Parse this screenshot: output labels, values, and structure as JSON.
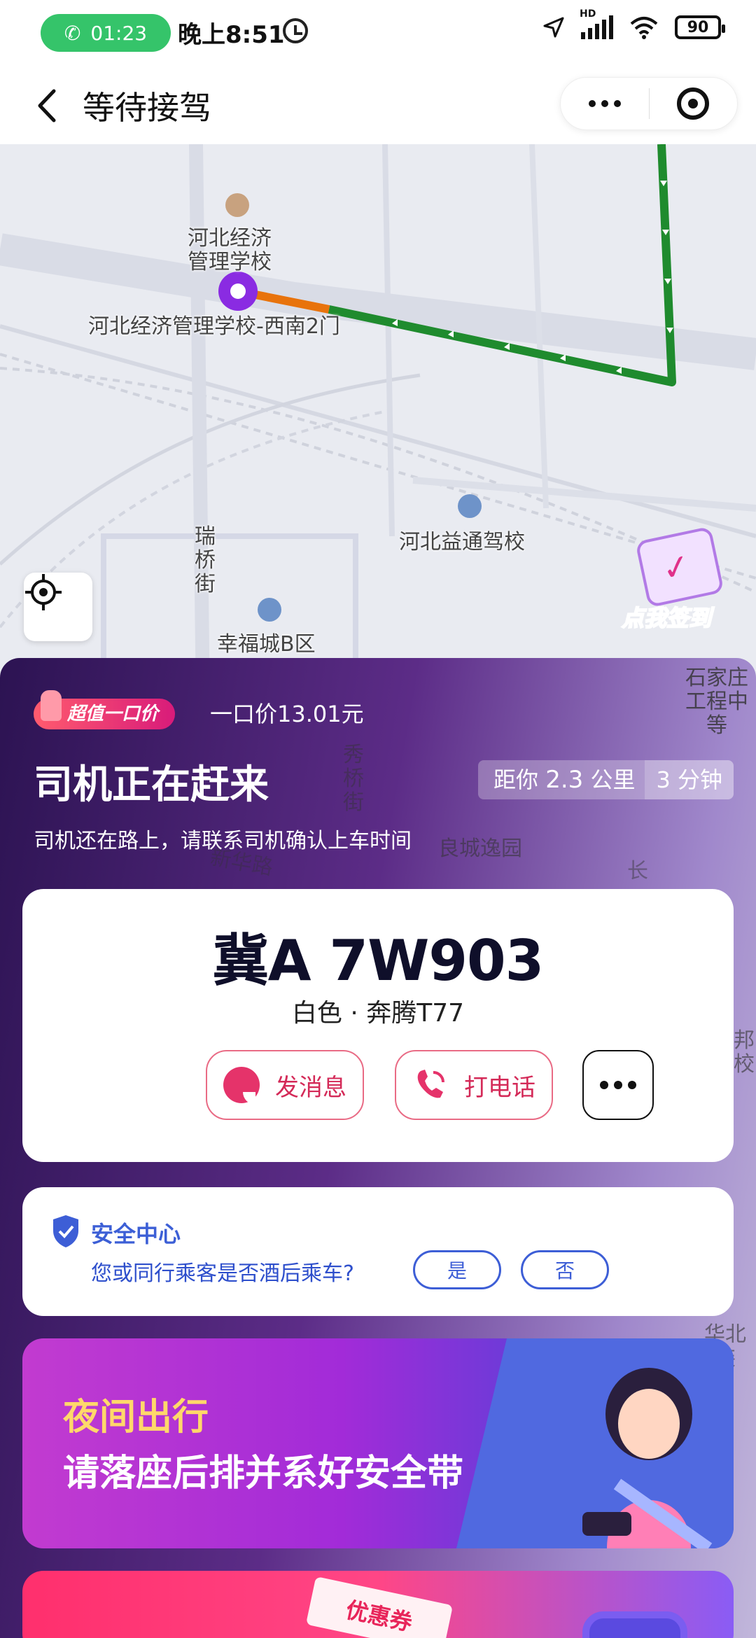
{
  "status_bar": {
    "call_timer": "01:23",
    "time": "晚上8:51",
    "network": "HD",
    "battery": "90"
  },
  "title_bar": {
    "title": "等待接驾"
  },
  "map": {
    "labels": {
      "school": "河北经济\n管理学校",
      "pickup": "河北经济管理学校-西南2门",
      "driving_school": "河北益通驾校",
      "street_ruiqiao": "瑞\n桥\n街",
      "xingfucheng": "幸福城B区",
      "shijiazhuang": "石家庄\n工程中等",
      "xiuqiao": "秀\n桥\n街",
      "liangcheng": "良城逸园",
      "xinhua": "新华路",
      "chang": "长",
      "bang": "邦\n校",
      "huabei": "华北\n装"
    },
    "signin_label": "点我签到"
  },
  "panel": {
    "badge": "超值一口价",
    "price_text": "一口价13.01元",
    "status_title": "司机正在赶来",
    "distance_prefix": "距你",
    "distance_value": "2.3",
    "distance_unit": "公里",
    "eta": "3 分钟",
    "subtitle": "司机还在路上，请联系司机确认上车时间"
  },
  "car": {
    "plate": "冀A 7W903",
    "description": "白色 · 奔腾T77",
    "message_label": "发消息",
    "call_label": "打电话"
  },
  "safety": {
    "title": "安全中心",
    "question": "您或同行乘客是否酒后乘车?",
    "yes": "是",
    "no": "否"
  },
  "banner": {
    "line1": "夜间出行",
    "line2": "请落座后排并系好安全带"
  },
  "banner2": {
    "coupon_label": "优惠券"
  },
  "colors": {
    "route_green": "#1f8b2e",
    "route_orange": "#e8730c",
    "pickup_purple": "#8a2be2",
    "panel_dark": "#2c1352",
    "accent_pink": "#d42a58",
    "safety_blue": "#3d5ed6",
    "call_green": "#35c46a"
  },
  "icons": {
    "call_pill": "phone-icon",
    "alarm": "alarm-icon",
    "location": "location-arrow-icon",
    "signal": "signal-icon",
    "wifi": "wifi-icon",
    "back": "back-chevron-icon",
    "more": "more-dots-icon",
    "close": "close-target-icon",
    "locate": "locate-crosshair-icon",
    "message": "message-bubble-icon",
    "phone": "phone-icon",
    "shield": "shield-check-icon"
  }
}
